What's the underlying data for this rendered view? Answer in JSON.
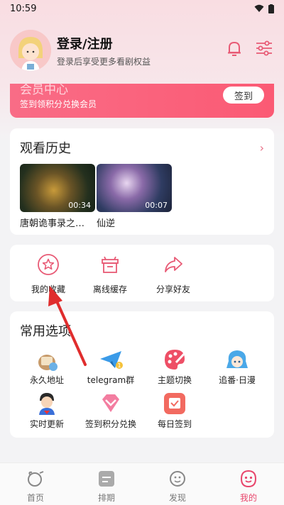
{
  "status": {
    "time": "10:59"
  },
  "profile": {
    "title": "登录/注册",
    "subtitle": "登录后享受更多看剧权益"
  },
  "member": {
    "title": "会员中心",
    "subtitle": "签到领积分兑换会员",
    "sign_label": "签到"
  },
  "history": {
    "title": "观看历史",
    "items": [
      {
        "title": "唐朝诡事录之…",
        "duration": "00:34"
      },
      {
        "title": "仙逆",
        "duration": "00:07"
      }
    ]
  },
  "actions": [
    {
      "label": "我的收藏",
      "icon": "star-icon"
    },
    {
      "label": "离线缓存",
      "icon": "cache-box-icon"
    },
    {
      "label": "分享好友",
      "icon": "share-arrow-icon"
    }
  ],
  "options": {
    "title": "常用选项",
    "items": [
      {
        "label": "永久地址",
        "icon": "permanent-address-icon"
      },
      {
        "label": "telegram群",
        "icon": "telegram-icon"
      },
      {
        "label": "主题切换",
        "icon": "palette-icon"
      },
      {
        "label": "追番·日漫",
        "icon": "anime-icon"
      },
      {
        "label": "实时更新",
        "icon": "realtime-update-icon"
      },
      {
        "label": "签到积分兑换",
        "icon": "points-exchange-icon"
      },
      {
        "label": "每日签到",
        "icon": "daily-checkin-icon"
      }
    ]
  },
  "nav": {
    "items": [
      {
        "label": "首页",
        "icon": "home-icon"
      },
      {
        "label": "排期",
        "icon": "schedule-icon"
      },
      {
        "label": "发现",
        "icon": "discover-icon"
      },
      {
        "label": "我的",
        "icon": "mine-icon"
      }
    ],
    "active_index": 3
  },
  "colors": {
    "accent": "#e8456b",
    "member_card": "#fb5a74",
    "page_bg": "#f3f3f5"
  }
}
